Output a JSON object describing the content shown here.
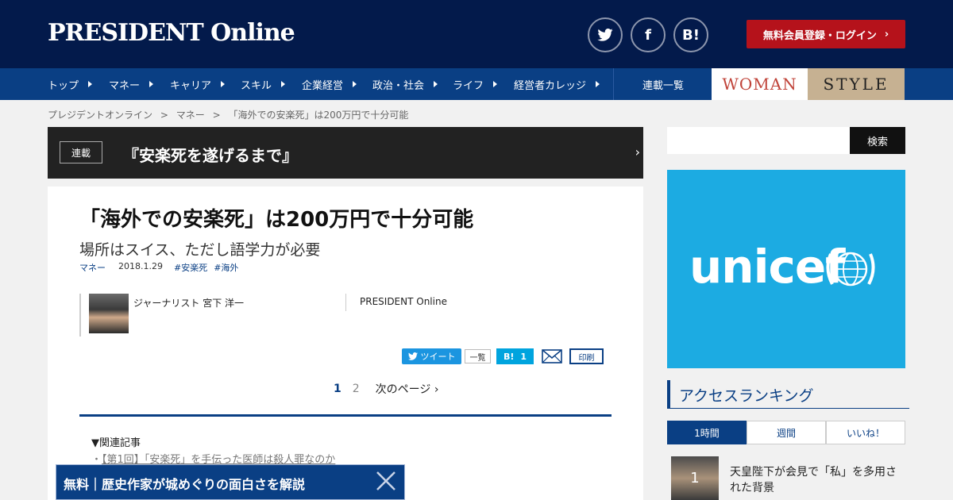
{
  "header": {
    "logo": "PRESIDENT Online",
    "social": [
      {
        "label": "",
        "icon": "twitter-icon"
      },
      {
        "label": "f",
        "icon": "facebook-icon"
      },
      {
        "label": "B!",
        "icon": "hatena-bookmark-icon"
      }
    ],
    "login_label": "無料会員登録・ログイン",
    "login_color": "#b5121b"
  },
  "nav": {
    "items": [
      "トップ",
      "マネー",
      "キャリア",
      "スキル",
      "企業経営",
      "政治・社会",
      "ライフ",
      "経営者カレッジ"
    ],
    "series_list": "連載一覧",
    "woman": "WOMAN",
    "style": "STYLE"
  },
  "breadcrumb": {
    "items": [
      "プレジデントオンライン",
      "マネー",
      "「海外での安楽死」は200万円で十分可能"
    ],
    "sep": ">"
  },
  "series": {
    "tag": "連載",
    "title": "『安楽死を遂げるまで』"
  },
  "article": {
    "title": "「海外での安楽死」は200万円で十分可能",
    "subtitle": "場所はスイス、ただし語学力が必要",
    "category": "マネー",
    "date": "2018.1.29",
    "tags": [
      "#安楽死",
      "#海外"
    ],
    "author": "ジャーナリスト 宮下 洋一",
    "publisher": "PRESIDENT Online"
  },
  "share": {
    "tweet": "ツイート",
    "list": "一覧",
    "hatena_label": "B!",
    "hatena_count": "1",
    "print": "印刷"
  },
  "pager": {
    "current": "1",
    "other": "2",
    "next": "次のページ"
  },
  "related": {
    "heading": "▼関連記事",
    "links": [
      "【第1回】「安楽死」を手伝った医師は殺人罪なのか"
    ]
  },
  "floating": {
    "text": "無料｜歴史作家が城めぐりの面白さを解説"
  },
  "sidebar": {
    "search_placeholder": "",
    "search_button": "検索",
    "ad_text": "unicef",
    "ranking_title": "アクセスランキング",
    "tabs": [
      "1時間",
      "週間",
      "いいね！"
    ],
    "rank1": {
      "num": "1",
      "text": "天皇陛下が会見で「私」を多用された背景"
    }
  },
  "colors": {
    "header_bg": "#031a4b",
    "nav_bg": "#0a3f84",
    "unicef_bg": "#1cabe2"
  }
}
